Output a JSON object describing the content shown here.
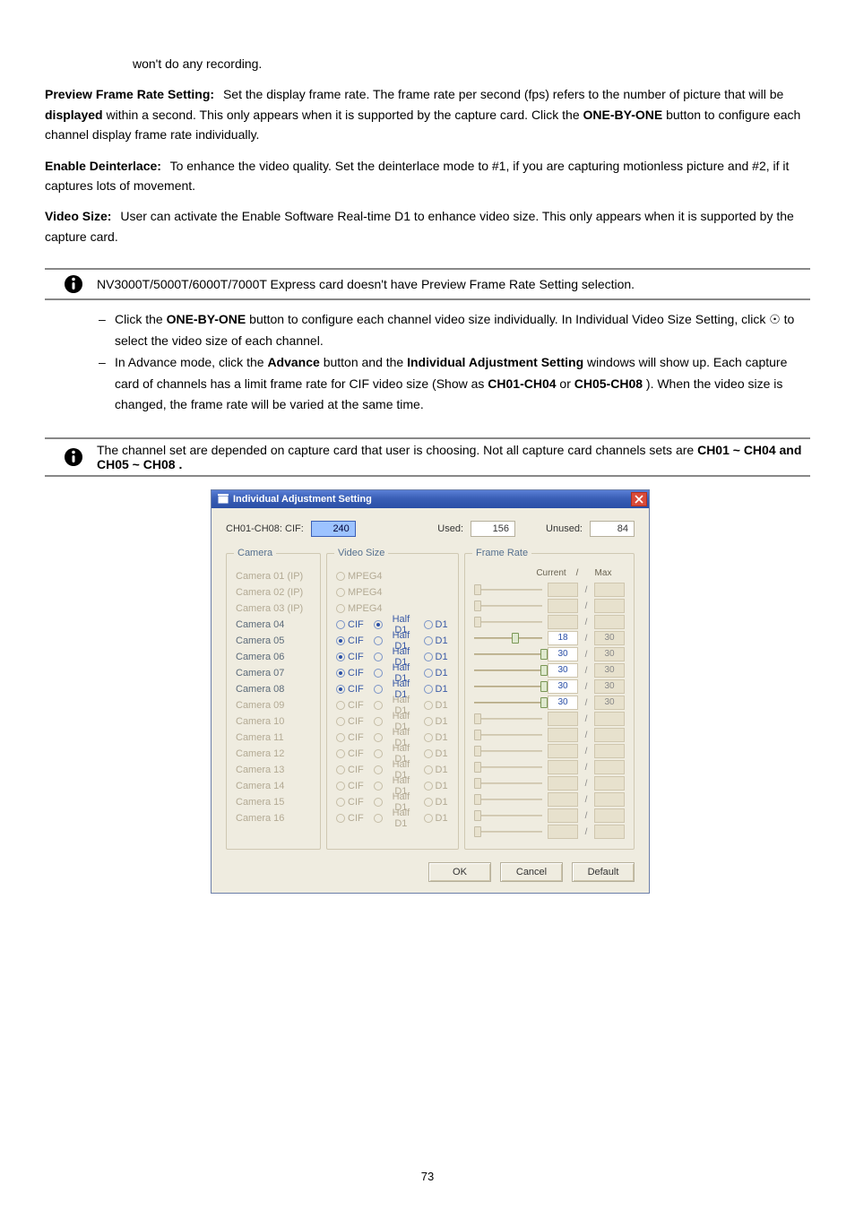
{
  "doc": {
    "leading_line": "won't do any recording.",
    "strong": {
      "preview_frame_rate": "Preview Frame Rate Setting:",
      "displayed": "displayed",
      "one_by_one": "ONE-BY-ONE",
      "advance": "Advance",
      "individual_adjustment": "Individual Adjustment Setting",
      "ch_set_a": "CH01-CH04",
      "or": "or",
      "ch_set_b": "CH05-CH08",
      "ch_group_a": "CH01 ~ CH04",
      "ch_group_b": " CH05 ~ CH08",
      "and": " and ",
      "dot": "."
    },
    "para2_a": " Set the display frame rate. The frame rate per second (fps) refers to the number of picture that will be ",
    "para2_b": " within a second. This only appears when it is supported by the capture card. Click the ",
    "para2_c": " button to configure each channel display frame rate individually.",
    "enable_deinterlace_label": "Enable Deinterlace:",
    "enable_deinterlace_text": " To enhance the video quality. Set the deinterlace mode to #1, if you are capturing motionless picture and #2, if it captures lots of movement.",
    "video_size_label": "Video Size:",
    "video_size_text": " User can activate the Enable Software Real-time D1 to enhance video size. This only appears when it is supported by the capture card.",
    "note1": "NV3000T/5000T/6000T/7000T Express card doesn't have Preview Frame Rate Setting selection.",
    "dash1_a": "Click the ",
    "dash1_b": " button to configure each channel video size individually. In Individual Video Size Setting, click ",
    "odot": "☉",
    "dash1_c": " to select the video size of each channel.",
    "dash2_a": "In Advance mode, click the ",
    "dash2_b": " button and the ",
    "dash2_c": " windows will show up. Each capture card of channels has a limit frame rate for CIF video size (Show as ",
    "dash2_d": "). When the video size is changed, the frame rate will be varied at the same time.",
    "note2_a": "The channel set are depended on capture card that user is choosing. Not all capture card channels sets are ",
    "note2_b": ""
  },
  "dlg": {
    "title": "Individual Adjustment Setting",
    "top": {
      "label": "CH01-CH08: CIF:",
      "cif_value": "240",
      "used_label": "Used:",
      "used_value": "156",
      "unused_label": "Unused:",
      "unused_value": "84"
    },
    "groups": {
      "camera": "Camera",
      "video": "Video Size",
      "frame": "Frame Rate",
      "current": "Current",
      "slash": "/",
      "max": "Max"
    },
    "options": {
      "cif": "CIF",
      "half": "Half D1",
      "d1": "D1",
      "mpeg4": "MPEG4"
    },
    "rows": [
      {
        "cam": "Camera 01 (IP)",
        "type": "mpeg4",
        "enabled": false,
        "sel": "",
        "cur": "",
        "max": "",
        "pos": 0
      },
      {
        "cam": "Camera 02 (IP)",
        "type": "mpeg4",
        "enabled": false,
        "sel": "",
        "cur": "",
        "max": "",
        "pos": 0
      },
      {
        "cam": "Camera 03 (IP)",
        "type": "mpeg4",
        "enabled": false,
        "sel": "",
        "cur": "",
        "max": "",
        "pos": 0
      },
      {
        "cam": "Camera 04",
        "type": "radio",
        "enabled": true,
        "sel": "half",
        "cur": "18",
        "max": "30",
        "pos": 55
      },
      {
        "cam": "Camera 05",
        "type": "radio",
        "enabled": true,
        "sel": "cif",
        "cur": "30",
        "max": "30",
        "pos": 98
      },
      {
        "cam": "Camera 06",
        "type": "radio",
        "enabled": true,
        "sel": "cif",
        "cur": "30",
        "max": "30",
        "pos": 98
      },
      {
        "cam": "Camera 07",
        "type": "radio",
        "enabled": true,
        "sel": "cif",
        "cur": "30",
        "max": "30",
        "pos": 98
      },
      {
        "cam": "Camera 08",
        "type": "radio",
        "enabled": true,
        "sel": "cif",
        "cur": "30",
        "max": "30",
        "pos": 98
      },
      {
        "cam": "Camera 09",
        "type": "radio",
        "enabled": false,
        "sel": "",
        "cur": "",
        "max": "",
        "pos": 0
      },
      {
        "cam": "Camera 10",
        "type": "radio",
        "enabled": false,
        "sel": "",
        "cur": "",
        "max": "",
        "pos": 0
      },
      {
        "cam": "Camera 11",
        "type": "radio",
        "enabled": false,
        "sel": "",
        "cur": "",
        "max": "",
        "pos": 0
      },
      {
        "cam": "Camera 12",
        "type": "radio",
        "enabled": false,
        "sel": "",
        "cur": "",
        "max": "",
        "pos": 0
      },
      {
        "cam": "Camera 13",
        "type": "radio",
        "enabled": false,
        "sel": "",
        "cur": "",
        "max": "",
        "pos": 0
      },
      {
        "cam": "Camera 14",
        "type": "radio",
        "enabled": false,
        "sel": "",
        "cur": "",
        "max": "",
        "pos": 0
      },
      {
        "cam": "Camera 15",
        "type": "radio",
        "enabled": false,
        "sel": "",
        "cur": "",
        "max": "",
        "pos": 0
      },
      {
        "cam": "Camera 16",
        "type": "radio",
        "enabled": false,
        "sel": "",
        "cur": "",
        "max": "",
        "pos": 0
      }
    ],
    "buttons": {
      "ok": "OK",
      "cancel": "Cancel",
      "default": "Default"
    }
  },
  "page_number": "73"
}
